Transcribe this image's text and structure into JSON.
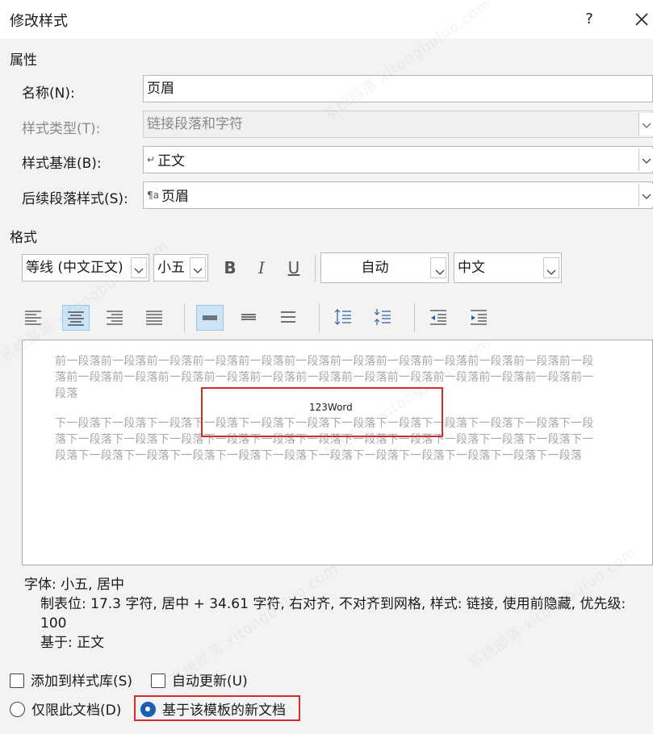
{
  "dialog": {
    "title": "修改样式",
    "help": "?"
  },
  "properties": {
    "heading": "属性",
    "name_label": "名称(N):",
    "name_value": "页眉",
    "type_label": "样式类型(T):",
    "type_value": "链接段落和字符",
    "based_label": "样式基准(B):",
    "based_value": "正文",
    "next_label": "后续段落样式(S):",
    "next_value": "页眉"
  },
  "format": {
    "heading": "格式",
    "font": "等线 (中文正文)",
    "size": "小五",
    "bold": "B",
    "italic": "I",
    "underline": "U",
    "color": "自动",
    "script": "中文"
  },
  "preview": {
    "prev_para": "前一段落前一段落前一段落前一段落前一段落前一段落前一段落前一段落前一段落前一段落前一段落前一段落前一段落前一段落前一段落前一段落前一段落前一段落前一段落前一段落前一段落前一段落前一段落前一段落",
    "sample": "123Word",
    "next_para": "下一段落下一段落下一段落下一段落下一段落下一段落下一段落下一段落下一段落下一段落下一段落下一段落下一段落下一段落下一段落下一段落下一段落下一段落下一段落下一段落下一段落下一段落下一段落下一段落下一段落下一段落下一段落下一段落下一段落下一段落下一段落下一段落下一段落下一段落下一段落"
  },
  "description": {
    "line1": "字体: 小五, 居中",
    "line2": "制表位:  17.3 字符, 居中 +  34.61 字符, 右对齐, 不对齐到网格, 样式: 链接, 使用前隐藏, 优先级: 100",
    "line3": "基于: 正文"
  },
  "options": {
    "add_to_gallery": "添加到样式库(S)",
    "auto_update": "自动更新(U)",
    "only_this_doc": "仅限此文档(D)",
    "new_docs_template": "基于该模板的新文档"
  },
  "watermark": "系统部落 xitongbuluo.com"
}
